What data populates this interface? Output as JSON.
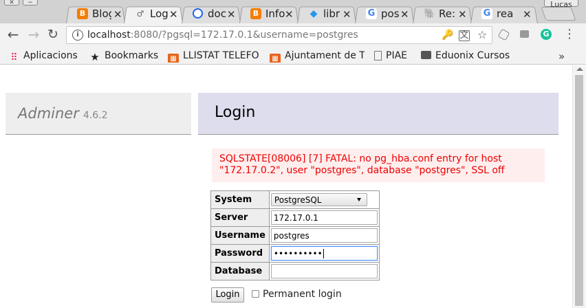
{
  "window": {
    "profile_label": "Lucas"
  },
  "tabs": [
    {
      "title": "Blog",
      "icon": "blogger-icon",
      "color": "#f57d00",
      "glyph": "B"
    },
    {
      "title": "Log",
      "icon": "adminer-favicon",
      "color": "#ffffff",
      "glyph": "",
      "active": true
    },
    {
      "title": "doc",
      "icon": "docker-docs-icon",
      "color": "#1d63ed",
      "glyph": ""
    },
    {
      "title": "Info",
      "icon": "blogger-icon",
      "color": "#f57d00",
      "glyph": "B"
    },
    {
      "title": "libr",
      "icon": "docker-whale-icon",
      "color": "#2496ed",
      "glyph": ""
    },
    {
      "title": "pos",
      "icon": "google-icon",
      "color": "#4285f4",
      "glyph": "G"
    },
    {
      "title": "Re:",
      "icon": "postgres-elephant-icon",
      "color": "#336791",
      "glyph": ""
    },
    {
      "title": "rea",
      "icon": "google-icon",
      "color": "#4285f4",
      "glyph": "G"
    }
  ],
  "toolbar": {
    "url_host": "localhost",
    "url_rest": ":8080/?pgsql=172.17.0.1&username=postgres"
  },
  "bookmarks": {
    "apps_label": "Aplicacions",
    "items": [
      {
        "label": "Bookmarks",
        "icon": "star-icon"
      },
      {
        "label": "LLISTAT TELEFO",
        "icon": "calc-icon"
      },
      {
        "label": "Ajuntament de T",
        "icon": "calc-icon"
      },
      {
        "label": "PIAE",
        "icon": "page-icon"
      },
      {
        "label": "Eduonix Cursos",
        "icon": "folder-icon"
      }
    ],
    "more": "»"
  },
  "adminer": {
    "name": "Adminer",
    "version": "4.6.2",
    "heading": "Login",
    "error": "SQLSTATE[08006] [7] FATAL: no pg_hba.conf entry for host \"172.17.0.2\", user \"postgres\", database \"postgres\", SSL off",
    "form": {
      "system_label": "System",
      "system_value": "PostgreSQL",
      "server_label": "Server",
      "server_value": "172.17.0.1",
      "username_label": "Username",
      "username_value": "postgres",
      "password_label": "Password",
      "password_value": "••••••••••",
      "database_label": "Database",
      "database_value": ""
    },
    "login_button": "Login",
    "permanent_label": "Permanent login"
  },
  "colors": {
    "accent": "#4d90fe",
    "error_text": "#ee0000",
    "error_bg": "#ffeeee",
    "heading_bg": "#ddddee"
  }
}
